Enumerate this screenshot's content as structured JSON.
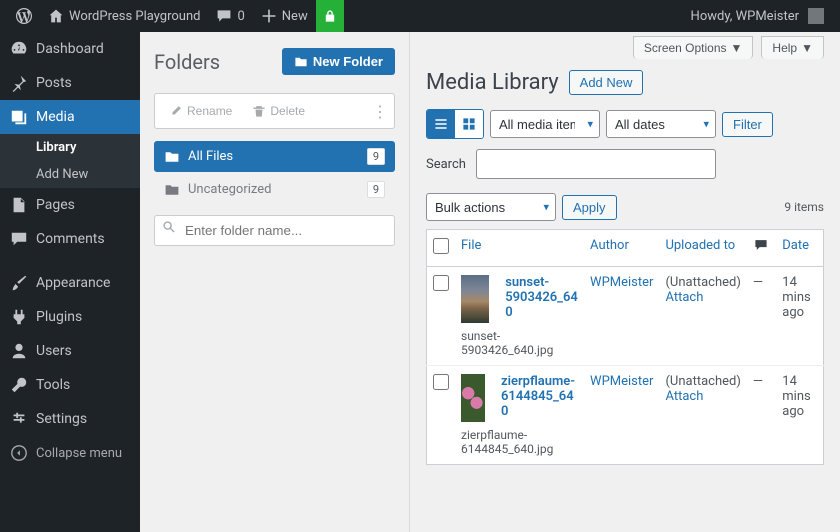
{
  "adminbar": {
    "site_title": "WordPress Playground",
    "comments_count": "0",
    "new_label": "New",
    "greeting": "Howdy, WPMeister"
  },
  "adminmenu": {
    "dashboard": "Dashboard",
    "posts": "Posts",
    "media": "Media",
    "media_sub": {
      "library": "Library",
      "add_new": "Add New"
    },
    "pages": "Pages",
    "comments": "Comments",
    "appearance": "Appearance",
    "plugins": "Plugins",
    "users": "Users",
    "tools": "Tools",
    "settings": "Settings",
    "collapse": "Collapse menu"
  },
  "folders": {
    "title": "Folders",
    "new_folder": "New Folder",
    "rename": "Rename",
    "delete": "Delete",
    "items": [
      {
        "label": "All Files",
        "count": "9",
        "active": true
      },
      {
        "label": "Uncategorized",
        "count": "9",
        "active": false
      }
    ],
    "search_placeholder": "Enter folder name..."
  },
  "main": {
    "screen_options": "Screen Options",
    "help": "Help",
    "title": "Media Library",
    "add_new": "Add New",
    "filter_media_types": "All media items",
    "filter_dates": "All dates",
    "filter_btn": "Filter",
    "search_label": "Search",
    "bulk_actions": "Bulk actions",
    "apply": "Apply",
    "items_count": "9 items",
    "cols": {
      "file": "File",
      "author": "Author",
      "uploaded": "Uploaded to",
      "date": "Date"
    },
    "rows": [
      {
        "title": "sunset-5903426_640",
        "filename": "sunset-5903426_640.jpg",
        "author": "WPMeister",
        "uploaded": "(Unattached)",
        "attach": "Attach",
        "comments": "—",
        "date": "14 mins ago",
        "thumb_class": "thumb-sunset"
      },
      {
        "title": "zierpflaume-6144845_640",
        "filename": "zierpflaume-6144845_640.jpg",
        "author": "WPMeister",
        "uploaded": "(Unattached)",
        "attach": "Attach",
        "comments": "—",
        "date": "14 mins ago",
        "thumb_class": "thumb-flower"
      }
    ]
  }
}
